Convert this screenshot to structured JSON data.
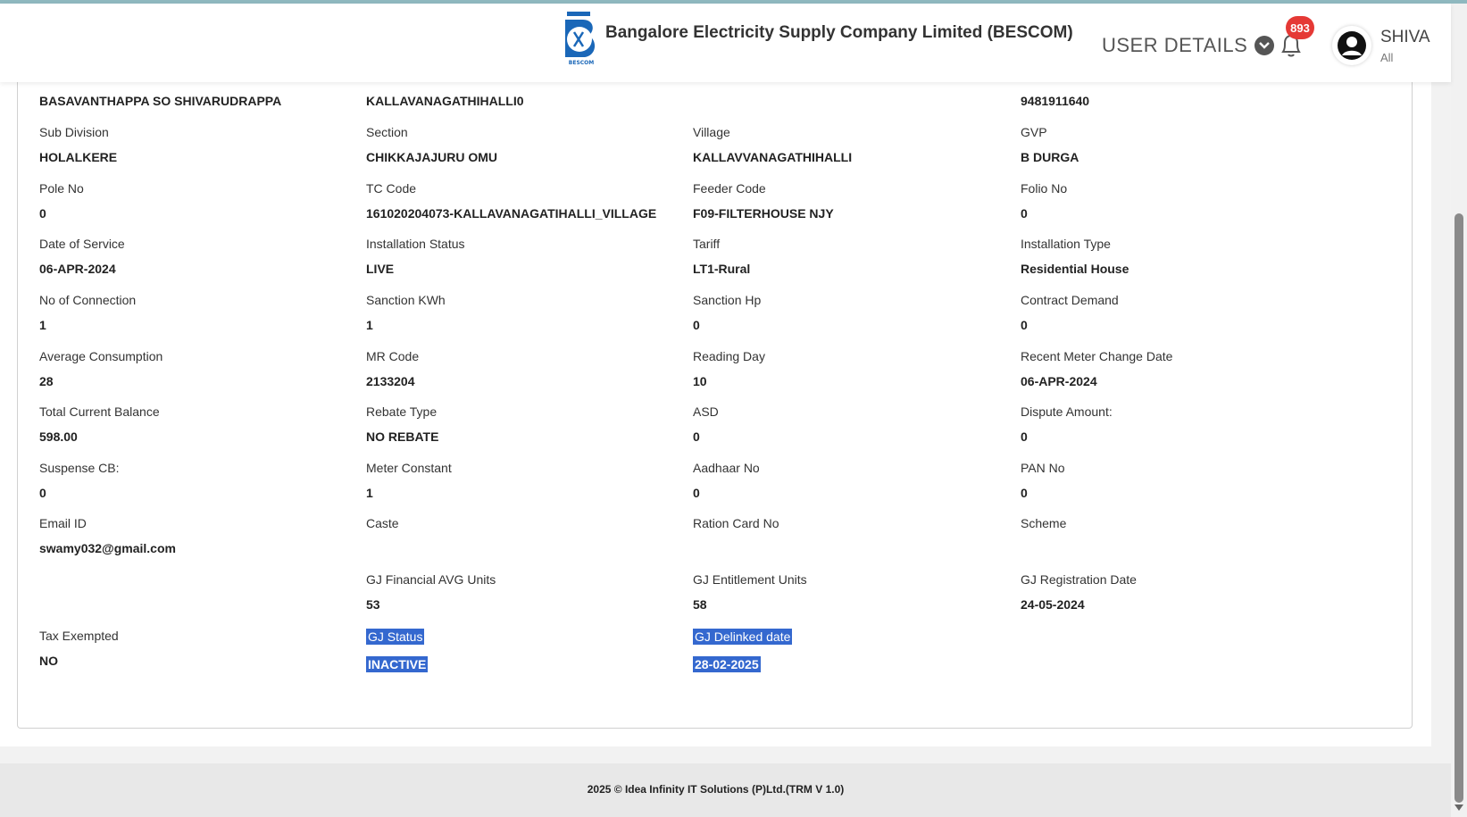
{
  "header": {
    "company": "Bangalore Electricity Supply Company Limited (BESCOM)",
    "logo_text": "BESCOM",
    "user_details_label": "USER DETAILS",
    "notification_count": "893",
    "user_name": "SHIVA",
    "user_role": "All"
  },
  "row0": {
    "c1": "BASAVANTHAPPA SO SHIVARUDRAPPA",
    "c2": "KALLAVANAGATHIHALLI0",
    "c4": "9481911640"
  },
  "rows": [
    [
      {
        "label": "Sub Division",
        "value": "HOLALKERE"
      },
      {
        "label": "Section",
        "value": "CHIKKAJAJURU OMU"
      },
      {
        "label": "Village",
        "value": "KALLAVVANAGATHIHALLI"
      },
      {
        "label": "GVP",
        "value": "B DURGA"
      }
    ],
    [
      {
        "label": "Pole No",
        "value": "0"
      },
      {
        "label": "TC Code",
        "value": "161020204073-KALLAVANAGATIHALLI_VILLAGE"
      },
      {
        "label": "Feeder Code",
        "value": "F09-FILTERHOUSE NJY"
      },
      {
        "label": "Folio No",
        "value": "0"
      }
    ],
    [
      {
        "label": "Date of Service",
        "value": "06-APR-2024"
      },
      {
        "label": "Installation Status",
        "value": "LIVE"
      },
      {
        "label": "Tariff",
        "value": "LT1-Rural"
      },
      {
        "label": "Installation Type",
        "value": "Residential House"
      }
    ],
    [
      {
        "label": "No of Connection",
        "value": "1"
      },
      {
        "label": "Sanction KWh",
        "value": "1"
      },
      {
        "label": "Sanction Hp",
        "value": "0"
      },
      {
        "label": "Contract Demand",
        "value": "0"
      }
    ],
    [
      {
        "label": "Average Consumption",
        "value": "28"
      },
      {
        "label": "MR Code",
        "value": "2133204"
      },
      {
        "label": "Reading Day",
        "value": "10"
      },
      {
        "label": "Recent Meter Change Date",
        "value": "06-APR-2024"
      }
    ],
    [
      {
        "label": "Total Current Balance",
        "value": "598.00"
      },
      {
        "label": "Rebate Type",
        "value": "NO REBATE"
      },
      {
        "label": "ASD",
        "value": "0"
      },
      {
        "label": "Dispute Amount:",
        "value": "0"
      }
    ],
    [
      {
        "label": "Suspense CB:",
        "value": "0"
      },
      {
        "label": "Meter Constant",
        "value": "1"
      },
      {
        "label": "Aadhaar No",
        "value": "0"
      },
      {
        "label": "PAN No",
        "value": "0"
      }
    ],
    [
      {
        "label": "Email ID",
        "value": "swamy032@gmail.com"
      },
      {
        "label": "Caste",
        "value": ""
      },
      {
        "label": "Ration Card No",
        "value": ""
      },
      {
        "label": "Scheme",
        "value": ""
      }
    ],
    [
      {
        "label": "",
        "value": ""
      },
      {
        "label": "GJ Financial AVG Units",
        "value": "53"
      },
      {
        "label": "GJ Entitlement Units",
        "value": "58"
      },
      {
        "label": "GJ Registration Date",
        "value": "24-05-2024"
      }
    ],
    [
      {
        "label": "Tax Exempted",
        "value": "NO"
      },
      {
        "label": "GJ Status",
        "value": "INACTIVE"
      },
      {
        "label": "GJ Delinked date",
        "value": "28-02-2025"
      },
      {
        "label": "",
        "value": ""
      }
    ]
  ],
  "footer": {
    "text": "2025 © Idea Infinity IT Solutions (P)Ltd.(TRM V 1.0)"
  }
}
